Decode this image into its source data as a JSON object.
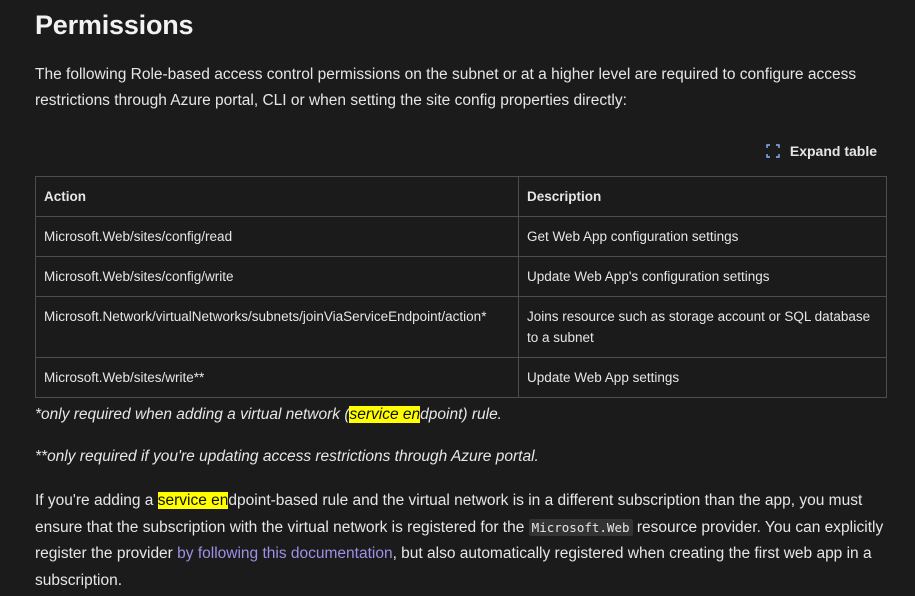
{
  "heading": "Permissions",
  "intro": "The following Role-based access control permissions on the subnet or at a higher level are required to configure access restrictions through Azure portal, CLI or when setting the site config properties directly:",
  "expand_table": {
    "label": "Expand table",
    "icon": "expand-icon"
  },
  "table": {
    "headers": [
      "Action",
      "Description"
    ],
    "rows": [
      {
        "action": "Microsoft.Web/sites/config/read",
        "description": "Get Web App configuration settings"
      },
      {
        "action": "Microsoft.Web/sites/config/write",
        "description": "Update Web App's configuration settings"
      },
      {
        "action": "Microsoft.Network/virtualNetworks/subnets/joinViaServiceEndpoint/action*",
        "description": "Joins resource such as storage account or SQL database to a subnet"
      },
      {
        "action": "Microsoft.Web/sites/write**",
        "description": "Update Web App settings"
      }
    ]
  },
  "note1": {
    "before": "*only required when adding a virtual network (",
    "highlight": "service en",
    "after": "dpoint) rule."
  },
  "note2": "**only required if you're updating access restrictions through Azure portal.",
  "paragraph": {
    "part1": "If you're adding a ",
    "highlight": "service en",
    "part2": "dpoint-based rule and the virtual network is in a different subscription than the app, you must ensure that the subscription with the virtual network is registered for the ",
    "code": "Microsoft.Web",
    "part3": " resource provider. You can explicitly register the provider ",
    "link": "by following this documentation",
    "part4": ", but also automatically registered when creating the first web app in a subscription."
  },
  "colors": {
    "background": "#1b1b1b",
    "highlight": "#ffff00",
    "link": "#9f8fe6"
  }
}
